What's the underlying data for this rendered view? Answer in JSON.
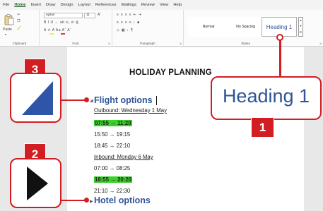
{
  "menu": [
    "File",
    "Home",
    "Insert",
    "Draw",
    "Design",
    "Layout",
    "References",
    "Mailings",
    "Review",
    "View",
    "Help"
  ],
  "ribbon": {
    "clipboard": {
      "paste": "Paste",
      "label": "Clipboard"
    },
    "font": {
      "name": "Aptos",
      "size": "11",
      "label": "Font",
      "row2": "B  I  U  ↔  ab  x₂  x²  A̲",
      "row3": "A  ✐  A  Aa  Aˆ  Aˇ"
    },
    "paragraph": {
      "label": "Paragraph",
      "row1": "≡ ≡ ≡ ≡  ⇤ ⇥",
      "row2": "≡ ≡ ≡ ≡  ↕ ■",
      "row3": "◇ ▦  ↓  ¶"
    },
    "styles": {
      "normal": "Normal",
      "no_spacing": "No Spacing",
      "heading1": "Heading 1",
      "label": "Styles"
    }
  },
  "document": {
    "title": "HOLIDAY PLANNING",
    "heading1": "Flight options",
    "outbound": "Outbound: Wednesday 1 May",
    "out_times": [
      "07:55 → 11:20",
      "15:50 → 19:15",
      "18:45 → 22:10"
    ],
    "inbound": "Inbound: Monday 6 May",
    "in_times": [
      "07:00 → 08:25",
      "18:55 → 20:20",
      "21:10 → 22:30"
    ],
    "heading2": "Hotel options"
  },
  "callouts": {
    "one": {
      "number": "1",
      "text": "Heading 1"
    },
    "two": {
      "number": "2"
    },
    "three": {
      "number": "3"
    }
  },
  "colors": {
    "accent_red": "#d21d22",
    "heading_blue": "#2f5496",
    "highlight_green": "#39d12a"
  }
}
